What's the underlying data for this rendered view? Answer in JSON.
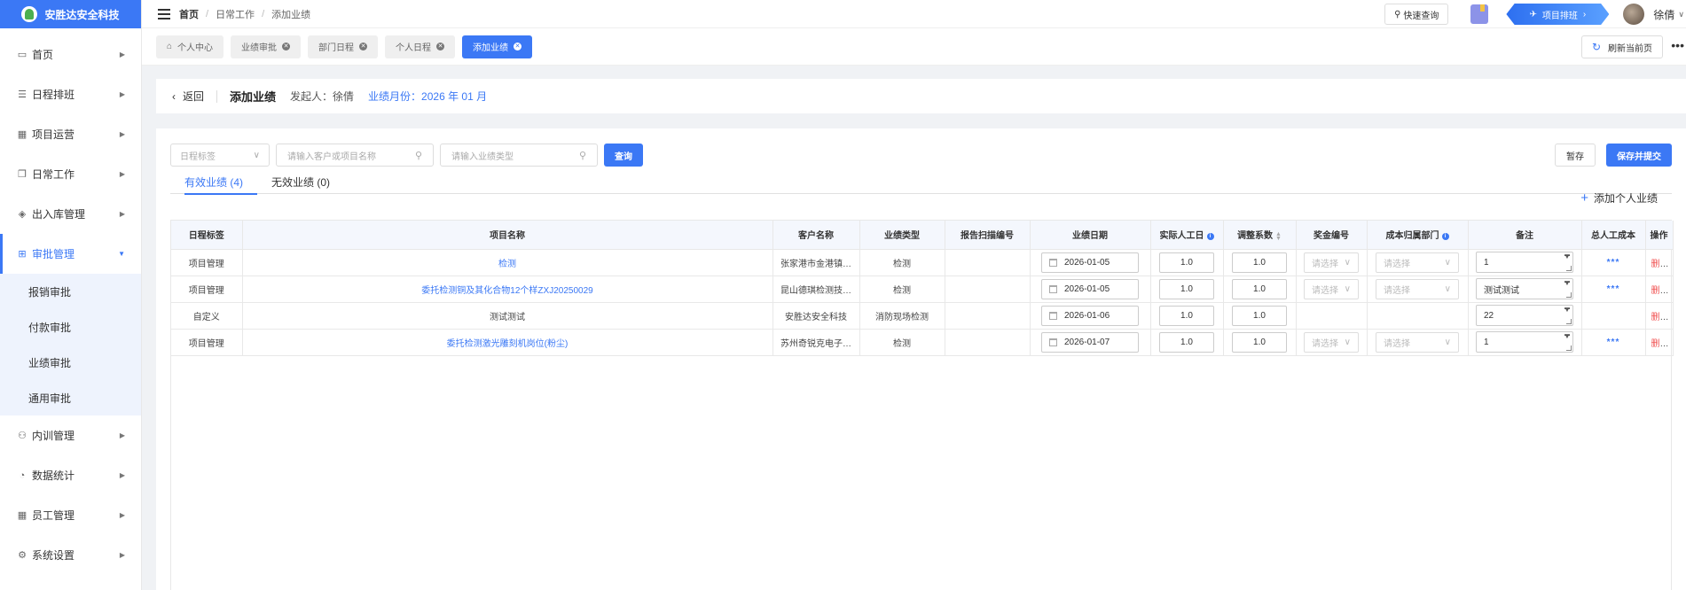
{
  "brand": {
    "name": "安胜达安全科技",
    "primary_color": "#3b78f5"
  },
  "sidebar": {
    "items": [
      {
        "label": "首页",
        "icon": "monitor-icon"
      },
      {
        "label": "日程排班",
        "icon": "calendar-list-icon"
      },
      {
        "label": "项目运营",
        "icon": "grid-icon"
      },
      {
        "label": "日常工作",
        "icon": "copy-icon"
      },
      {
        "label": "出入库管理",
        "icon": "layers-icon"
      },
      {
        "label": "审批管理",
        "icon": "approval-icon",
        "active": true
      },
      {
        "label": "内训管理",
        "icon": "training-icon"
      },
      {
        "label": "数据统计",
        "icon": "pie-icon"
      },
      {
        "label": "员工管理",
        "icon": "staff-icon"
      },
      {
        "label": "系统设置",
        "icon": "gear-icon"
      }
    ],
    "subitems": [
      "报销审批",
      "付款审批",
      "业绩审批",
      "通用审批"
    ]
  },
  "header": {
    "breadcrumb": [
      "首页",
      "日常工作",
      "添加业绩"
    ],
    "quick_search": "快速查询",
    "project_schedule": "项目排班",
    "username": "徐倩"
  },
  "tabs": [
    {
      "label": "个人中心",
      "active": false,
      "closable": false
    },
    {
      "label": "业绩审批",
      "active": false,
      "closable": true
    },
    {
      "label": "部门日程",
      "active": false,
      "closable": true
    },
    {
      "label": "个人日程",
      "active": false,
      "closable": true
    },
    {
      "label": "添加业绩",
      "active": true,
      "closable": true
    }
  ],
  "refresh_label": "刷新当前页",
  "backbar": {
    "back": "返回",
    "title": "添加业绩",
    "initiator": "发起人：徐倩",
    "month": "业绩月份：2026 年 01 月"
  },
  "filters": {
    "schedule_tag_placeholder": "日程标签",
    "customer_placeholder": "请输入客户或项目名称",
    "type_placeholder": "请输入业绩类型",
    "query": "查询",
    "save_draft": "暂存",
    "save_submit": "保存并提交"
  },
  "subtabs": {
    "valid": "有效业绩 (4)",
    "invalid": "无效业绩 (0)",
    "add_personal": "添加个人业绩"
  },
  "table": {
    "headers": [
      "日程标签",
      "项目名称",
      "客户名称",
      "业绩类型",
      "报告扫描编号",
      "业绩日期",
      "实际人工日",
      "调整系数",
      "奖金编号",
      "成本归属部门",
      "备注",
      "总人工成本",
      "操作"
    ],
    "select_placeholder": "请选择",
    "select_placeholder_short": "请选择",
    "rows": [
      {
        "tag": "项目管理",
        "project": "检测",
        "project_link": true,
        "customer": "张家港市金港镇…",
        "type": "检测",
        "report_no": "",
        "date": "2026-01-05",
        "days": "1.0",
        "coef": "1.0",
        "note": "1",
        "cost": "***",
        "op": "删除"
      },
      {
        "tag": "项目管理",
        "project": "委托检测铜及其化合物12个样ZXJ20250029",
        "project_link": true,
        "customer": "昆山德琪检测技…",
        "type": "检测",
        "report_no": "",
        "date": "2026-01-05",
        "days": "1.0",
        "coef": "1.0",
        "note": "测试测试",
        "cost": "***",
        "op": "删除"
      },
      {
        "tag": "自定义",
        "project": "测试测试",
        "project_link": false,
        "customer": "安胜达安全科技",
        "type": "消防现场检测",
        "report_no": "",
        "date": "2026-01-06",
        "days": "1.0",
        "coef": "1.0",
        "note": "22",
        "cost": "",
        "op": "删除"
      },
      {
        "tag": "项目管理",
        "project": "委托检测激光雕刻机岗位(粉尘)",
        "project_link": true,
        "customer": "苏州奇锐克电子…",
        "type": "检测",
        "report_no": "",
        "date": "2026-01-07",
        "days": "1.0",
        "coef": "1.0",
        "note": "1",
        "cost": "***",
        "op": "删除"
      }
    ]
  }
}
